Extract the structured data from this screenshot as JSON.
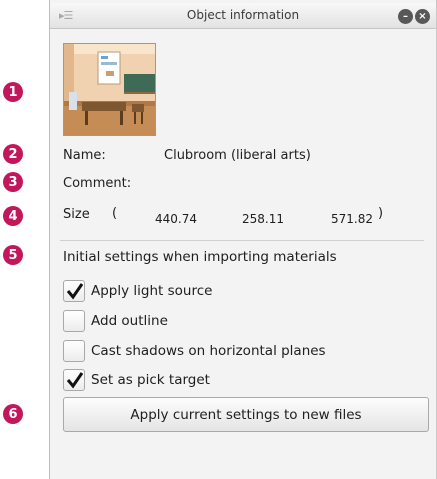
{
  "panel": {
    "title": "Object information",
    "grip_icon": "panel-grip-icon",
    "minimize_icon": "minimize-icon",
    "close_icon": "close-icon"
  },
  "callouts": [
    "1",
    "2",
    "3",
    "4",
    "5",
    "6"
  ],
  "thumbnail": {
    "alt": "Classroom preview"
  },
  "info": {
    "name_label": "Name:",
    "name_value": "Clubroom (liberal arts)",
    "comment_label": "Comment:",
    "size_label": "Size",
    "size_open": "(",
    "size_x": "440.74",
    "size_y": "258.11",
    "size_z": "571.82",
    "size_close": ")"
  },
  "settings": {
    "heading": "Initial settings when importing materials",
    "options": [
      {
        "label": "Apply light source",
        "checked": true
      },
      {
        "label": "Add outline",
        "checked": false
      },
      {
        "label": "Cast shadows on horizontal planes",
        "checked": false
      },
      {
        "label": "Set as pick target",
        "checked": true
      }
    ],
    "apply_button": "Apply current settings to new files"
  },
  "colors": {
    "callout": "#c2185b",
    "panel_bg": "#f3f3f3",
    "title_bar": "#e6e6e6"
  }
}
